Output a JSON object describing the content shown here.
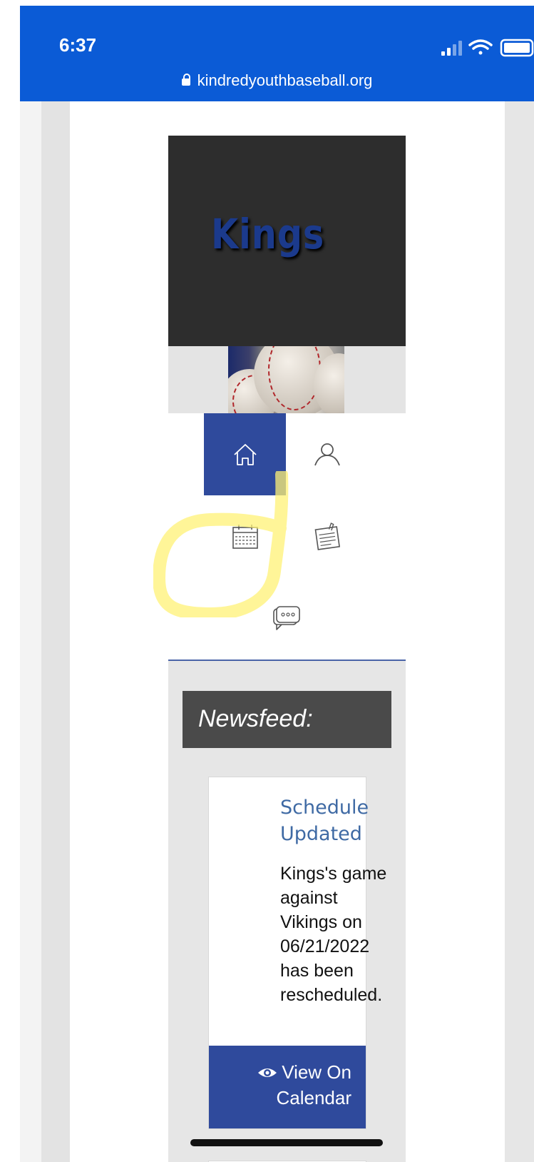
{
  "status_bar": {
    "time": "6:37"
  },
  "browser": {
    "url": "kindredyouthbaseball.org"
  },
  "team": {
    "logo_text": "Kings"
  },
  "nav": {
    "items": [
      {
        "name": "home",
        "icon": "home-icon"
      },
      {
        "name": "roster",
        "icon": "person-icon"
      },
      {
        "name": "calendar",
        "icon": "calendar-icon"
      },
      {
        "name": "notes",
        "icon": "notepad-icon"
      },
      {
        "name": "messages",
        "icon": "chat-icon"
      }
    ],
    "active": "home"
  },
  "newsfeed": {
    "heading": "Newsfeed:",
    "items": [
      {
        "title": "Schedule Updated",
        "body": "Kings's game against Vikings on 06/21/2022 has been rescheduled.",
        "button_line1": "View On",
        "button_line2": "Calendar",
        "button_icon": "eye-icon"
      }
    ]
  },
  "colors": {
    "browser_bar": "#0b5bd6",
    "accent": "#2f4a9c",
    "title_link": "#3f6aa4",
    "highlight": "#fff275"
  }
}
